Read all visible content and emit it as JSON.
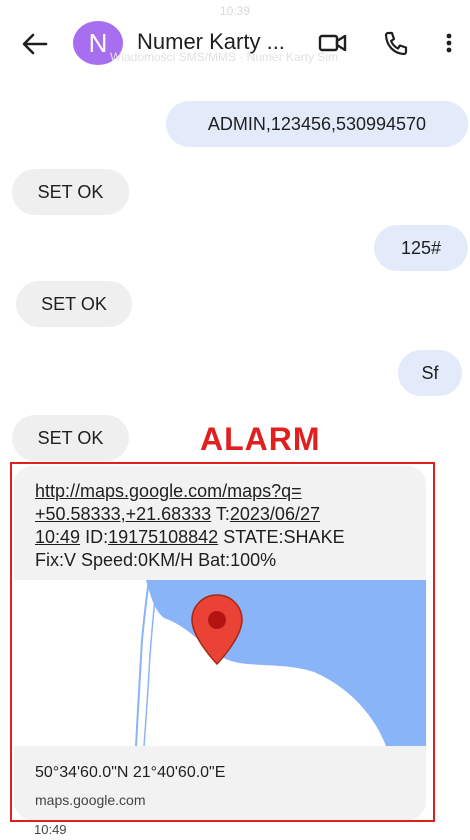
{
  "status": {
    "time": "10:39"
  },
  "header": {
    "avatar_letter": "N",
    "title": "Numer Karty ...",
    "subtitle": "Wiadomości SMS/MMS · Numer Karty Sim"
  },
  "messages": [
    {
      "dir": "outgoing",
      "text": "ADMIN,123456,530994570"
    },
    {
      "dir": "incoming",
      "text": "SET OK"
    },
    {
      "dir": "outgoing",
      "text": "125#"
    },
    {
      "dir": "incoming",
      "text": "SET OK"
    },
    {
      "dir": "outgoing",
      "text": "Sf"
    },
    {
      "dir": "incoming",
      "text": "SET OK"
    }
  ],
  "annotation": {
    "label": "ALARM",
    "color": "#e01f1f"
  },
  "alarm_message": {
    "link_line1": "http://maps.google.com/maps?q=",
    "link_line2": "+50.58333,+21.68333",
    "t_label": "T:",
    "date": "2023/06/27",
    "time": "10:49",
    "id_label": "ID:",
    "id_value": "19175108842",
    "state": "STATE:SHAKE",
    "line4": "Fix:V Speed:0KM/H Bat:100%",
    "map_coords": "50°34'60.0\"N 21°40'60.0\"E",
    "map_domain": "maps.google.com",
    "timestamp": "10:49"
  },
  "colors": {
    "avatar": "#a86ef0",
    "outgoing_bubble": "#e3ebfa",
    "incoming_bubble": "#efefef",
    "map_water": "#8ab4f8",
    "map_pin": "#ea4335"
  },
  "icons": {
    "back": "arrow-left",
    "video": "video-camera",
    "phone": "phone-handset",
    "menu": "vertical-dots",
    "pin": "map-pin"
  }
}
